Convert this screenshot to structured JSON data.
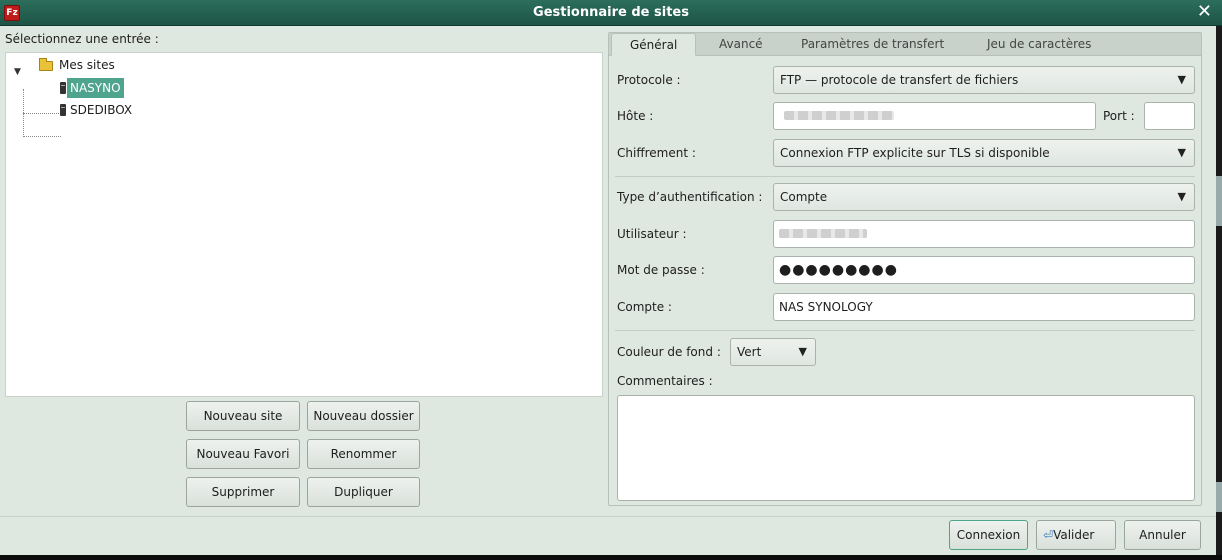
{
  "window": {
    "title": "Gestionnaire de sites",
    "app_icon_text": "Fz",
    "close_glyph": "✕"
  },
  "sites": {
    "select_label": "Sélectionnez une entrée :",
    "root": "Mes sites",
    "items": [
      {
        "label": "NASYNO",
        "selected": true
      },
      {
        "label": "SDEDIBOX",
        "selected": false
      }
    ]
  },
  "left_buttons": {
    "new_site": "Nouveau site",
    "new_folder": "Nouveau dossier",
    "new_bookmark": "Nouveau Favori",
    "rename": "Renommer",
    "delete": "Supprimer",
    "duplicate": "Dupliquer"
  },
  "tabs": [
    "Général",
    "Avancé",
    "Paramètres de transfert",
    "Jeu de caractères"
  ],
  "general": {
    "protocol_label": "Protocole :",
    "protocol_value": "FTP — protocole de transfert de fichiers",
    "host_label": "Hôte :",
    "host_value": "",
    "port_label": "Port :",
    "port_value": "",
    "encryption_label": "Chiffrement :",
    "encryption_value": "Connexion FTP explicite sur TLS si disponible",
    "auth_label": "Type d’authentification :",
    "auth_value": "Compte",
    "user_label": "Utilisateur :",
    "user_value": "",
    "password_label": "Mot de passe :",
    "password_value": "●●●●●●●●●",
    "account_label": "Compte :",
    "account_value": "NAS SYNOLOGY",
    "bgcolor_label": "Couleur de fond :",
    "bgcolor_value": "Vert",
    "comments_label": "Commentaires :",
    "comments_value": ""
  },
  "footer": {
    "connect": "Connexion",
    "ok": "Valider",
    "cancel": "Annuler"
  },
  "colors": {
    "titlebar": "#1d5445",
    "selection": "#4ea48c",
    "window_bg": "#dfe7e1"
  }
}
